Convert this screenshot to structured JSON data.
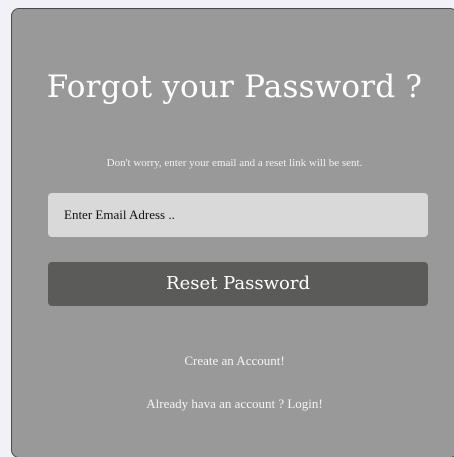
{
  "form": {
    "title": "Forgot your Password ?",
    "subtitle": "Don't worry, enter your email and a reset link will be sent.",
    "email_placeholder": "Enter Email Adress ..",
    "email_value": "",
    "reset_button_label": "Reset Password",
    "create_account_link": "Create an Account!",
    "login_link": "Already hava an account ? Login!"
  },
  "colors": {
    "card_background": "#999999",
    "input_background": "#d9d9d9",
    "button_background": "#5b5b59",
    "text": "#ffffff"
  }
}
